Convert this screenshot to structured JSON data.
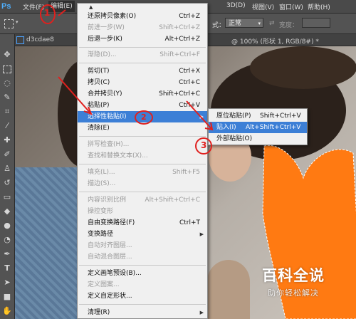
{
  "app": {
    "logo": "Ps"
  },
  "menubar": {
    "items": [
      "文件(F)",
      "编辑(E)",
      "3D(D)",
      "视图(V)",
      "窗口(W)",
      "帮助(H)"
    ]
  },
  "options": {
    "style_label": "式：",
    "style_value": "正常",
    "width_label": "宽度："
  },
  "document": {
    "tab_left": "d3cdae8",
    "tab_right": "@ 100% (形状 1, RGB/8#) *"
  },
  "edit_menu": {
    "items": [
      {
        "label": "还原拷贝像素(O)",
        "shortcut": "Ctrl+Z",
        "enabled": true
      },
      {
        "label": "前进一步(W)",
        "shortcut": "Shift+Ctrl+Z",
        "enabled": false
      },
      {
        "label": "后退一步(K)",
        "shortcut": "Alt+Ctrl+Z",
        "enabled": true
      },
      {
        "label": "渐隐(D)...",
        "shortcut": "Shift+Ctrl+F",
        "enabled": false
      },
      {
        "label": "剪切(T)",
        "shortcut": "Ctrl+X",
        "enabled": true
      },
      {
        "label": "拷贝(C)",
        "shortcut": "Ctrl+C",
        "enabled": true
      },
      {
        "label": "合并拷贝(Y)",
        "shortcut": "Shift+Ctrl+C",
        "enabled": true
      },
      {
        "label": "粘贴(P)",
        "shortcut": "Ctrl+V",
        "enabled": true
      },
      {
        "label": "选择性粘贴(I)",
        "shortcut": "",
        "enabled": true,
        "highlighted": true,
        "submenu": true
      },
      {
        "label": "清除(E)",
        "shortcut": "",
        "enabled": true
      },
      {
        "label": "拼写检查(H)...",
        "shortcut": "",
        "enabled": false
      },
      {
        "label": "查找和替换文本(X)...",
        "shortcut": "",
        "enabled": false
      },
      {
        "label": "填充(L)...",
        "shortcut": "Shift+F5",
        "enabled": false
      },
      {
        "label": "描边(S)...",
        "shortcut": "",
        "enabled": false
      },
      {
        "label": "内容识别比例",
        "shortcut": "Alt+Shift+Ctrl+C",
        "enabled": false
      },
      {
        "label": "操控变形",
        "shortcut": "",
        "enabled": false
      },
      {
        "label": "自由变换路径(F)",
        "shortcut": "Ctrl+T",
        "enabled": true
      },
      {
        "label": "变换路径",
        "shortcut": "",
        "enabled": true,
        "submenu": true
      },
      {
        "label": "自动对齐图层...",
        "shortcut": "",
        "enabled": false
      },
      {
        "label": "自动混合图层...",
        "shortcut": "",
        "enabled": false
      },
      {
        "label": "定义画笔预设(B)...",
        "shortcut": "",
        "enabled": true
      },
      {
        "label": "定义图案...",
        "shortcut": "",
        "enabled": false
      },
      {
        "label": "定义自定形状...",
        "shortcut": "",
        "enabled": true
      },
      {
        "label": "清理(R)",
        "shortcut": "",
        "enabled": true,
        "submenu": true
      }
    ]
  },
  "paste_special_menu": {
    "items": [
      {
        "label": "原位粘贴(P)",
        "shortcut": "Shift+Ctrl+V",
        "highlighted": false
      },
      {
        "label": "贴入(I)",
        "shortcut": "Alt+Shift+Ctrl+V",
        "highlighted": true
      },
      {
        "label": "外部粘贴(O)",
        "shortcut": "",
        "highlighted": false
      }
    ]
  },
  "annotations": {
    "step1": "1",
    "step2": "2",
    "step3": "3"
  },
  "watermark": {
    "title": "百科全说",
    "subtitle": "助你轻松解决"
  },
  "colors": {
    "highlight": "#3c7fd6",
    "annotation_red": "#e0201e",
    "heart_orange": "#ff7a12"
  }
}
